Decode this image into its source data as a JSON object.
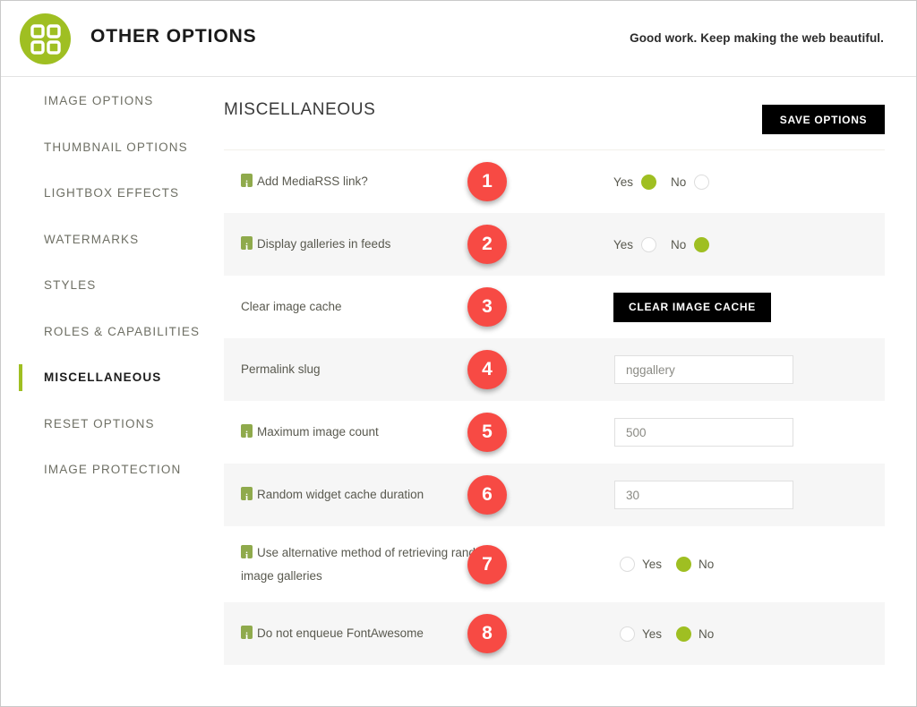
{
  "header": {
    "logo_icon": "grid-squares-icon",
    "logo_color": "#9fbf22",
    "title": "OTHER OPTIONS",
    "tagline": "Good work. Keep making the web beautiful."
  },
  "sidebar": {
    "items": [
      {
        "label": "IMAGE OPTIONS",
        "active": false
      },
      {
        "label": "THUMBNAIL OPTIONS",
        "active": false
      },
      {
        "label": "LIGHTBOX EFFECTS",
        "active": false
      },
      {
        "label": "WATERMARKS",
        "active": false
      },
      {
        "label": "STYLES",
        "active": false
      },
      {
        "label": "ROLES & CAPABILITIES",
        "active": false
      },
      {
        "label": "MISCELLANEOUS",
        "active": true
      },
      {
        "label": "RESET OPTIONS",
        "active": false
      },
      {
        "label": "IMAGE PROTECTION",
        "active": false
      }
    ],
    "active_accent_color": "#9fbf22"
  },
  "main": {
    "section_title": "MISCELLANEOUS",
    "save_button_label": "SAVE OPTIONS",
    "badge_color": "#f74a44",
    "radio_on_color": "#9fbf22",
    "rows": [
      {
        "badge": "1",
        "label": "Add MediaRSS link?",
        "has_info_icon": true,
        "control": "radio",
        "radio_order": "label-first",
        "options": [
          {
            "label": "Yes",
            "selected": true
          },
          {
            "label": "No",
            "selected": false
          }
        ]
      },
      {
        "badge": "2",
        "label": "Display galleries in feeds",
        "has_info_icon": true,
        "control": "radio",
        "radio_order": "label-first",
        "options": [
          {
            "label": "Yes",
            "selected": false
          },
          {
            "label": "No",
            "selected": true
          }
        ]
      },
      {
        "badge": "3",
        "label": "Clear image cache",
        "has_info_icon": false,
        "control": "button",
        "button_label": "CLEAR IMAGE CACHE"
      },
      {
        "badge": "4",
        "label": "Permalink slug",
        "has_info_icon": false,
        "control": "input",
        "input_value": "nggallery",
        "input_placeholder": "nggallery"
      },
      {
        "badge": "5",
        "label": "Maximum image count",
        "has_info_icon": true,
        "control": "input",
        "input_value": "500",
        "input_placeholder": "500"
      },
      {
        "badge": "6",
        "label": "Random widget cache duration",
        "has_info_icon": true,
        "control": "input",
        "input_value": "30",
        "input_placeholder": "30"
      },
      {
        "badge": "7",
        "label": "Use alternative method of retrieving random image galleries",
        "has_info_icon": true,
        "control": "radio",
        "radio_order": "label-after",
        "options": [
          {
            "label": "Yes",
            "selected": false
          },
          {
            "label": "No",
            "selected": true
          }
        ]
      },
      {
        "badge": "8",
        "label": "Do not enqueue FontAwesome",
        "has_info_icon": true,
        "control": "radio",
        "radio_order": "label-after",
        "options": [
          {
            "label": "Yes",
            "selected": false
          },
          {
            "label": "No",
            "selected": true
          }
        ]
      }
    ]
  }
}
